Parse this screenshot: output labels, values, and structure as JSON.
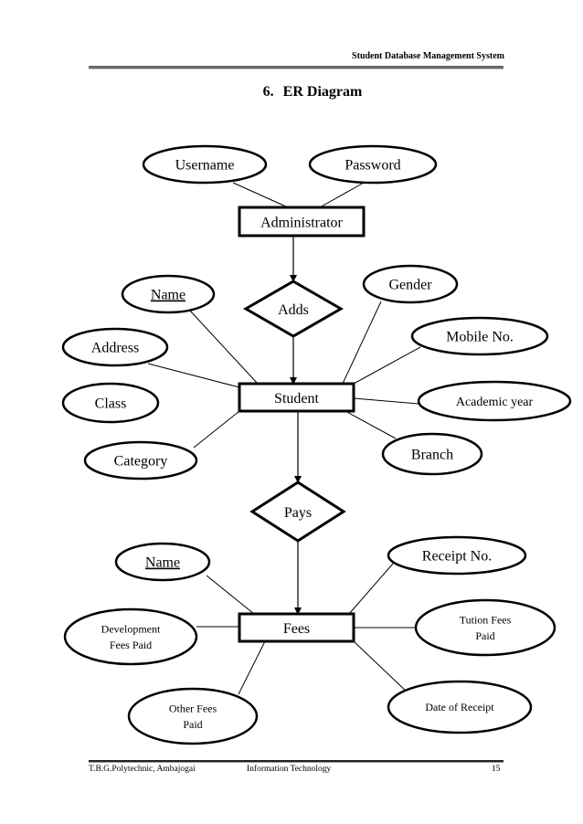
{
  "header": {
    "title": "Student Database Management System"
  },
  "heading": {
    "number": "6.",
    "title": "ER Diagram"
  },
  "footer": {
    "institute": "T.B.G.Polytechnic, Ambajogai",
    "department": "Information Technology",
    "page_number": "15"
  },
  "diagram": {
    "entities": [
      {
        "id": "administrator",
        "label": "Administrator"
      },
      {
        "id": "student",
        "label": "Student"
      },
      {
        "id": "fees",
        "label": "Fees"
      }
    ],
    "relationships": [
      {
        "id": "adds",
        "label": "Adds",
        "from": "administrator",
        "to": "student"
      },
      {
        "id": "pays",
        "label": "Pays",
        "from": "student",
        "to": "fees"
      }
    ],
    "attributes": [
      {
        "id": "username",
        "lines": [
          "Username"
        ],
        "entity": "administrator",
        "key": false
      },
      {
        "id": "password",
        "lines": [
          "Password"
        ],
        "entity": "administrator",
        "key": false
      },
      {
        "id": "student-name",
        "lines": [
          "Name"
        ],
        "entity": "student",
        "key": true
      },
      {
        "id": "address",
        "lines": [
          "Address"
        ],
        "entity": "student",
        "key": false
      },
      {
        "id": "class",
        "lines": [
          "Class"
        ],
        "entity": "student",
        "key": false,
        "connected": false
      },
      {
        "id": "category",
        "lines": [
          "Category"
        ],
        "entity": "student",
        "key": false
      },
      {
        "id": "gender",
        "lines": [
          "Gender"
        ],
        "entity": "student",
        "key": false
      },
      {
        "id": "mobile-no",
        "lines": [
          "Mobile No."
        ],
        "entity": "student",
        "key": false
      },
      {
        "id": "academic-year",
        "lines": [
          "Academic year"
        ],
        "entity": "student",
        "key": false
      },
      {
        "id": "branch",
        "lines": [
          "Branch"
        ],
        "entity": "student",
        "key": false
      },
      {
        "id": "fees-name",
        "lines": [
          "Name"
        ],
        "entity": "fees",
        "key": true
      },
      {
        "id": "development-fees-paid",
        "lines": [
          "Development",
          "Fees Paid"
        ],
        "entity": "fees",
        "key": false
      },
      {
        "id": "other-fees-paid",
        "lines": [
          "Other Fees",
          "Paid"
        ],
        "entity": "fees",
        "key": false
      },
      {
        "id": "receipt-no",
        "lines": [
          "Receipt No."
        ],
        "entity": "fees",
        "key": false
      },
      {
        "id": "tution-fees-paid",
        "lines": [
          "Tution Fees",
          "Paid"
        ],
        "entity": "fees",
        "key": false
      },
      {
        "id": "date-of-receipt",
        "lines": [
          "Date of Receipt"
        ],
        "entity": "fees",
        "key": false
      }
    ]
  }
}
